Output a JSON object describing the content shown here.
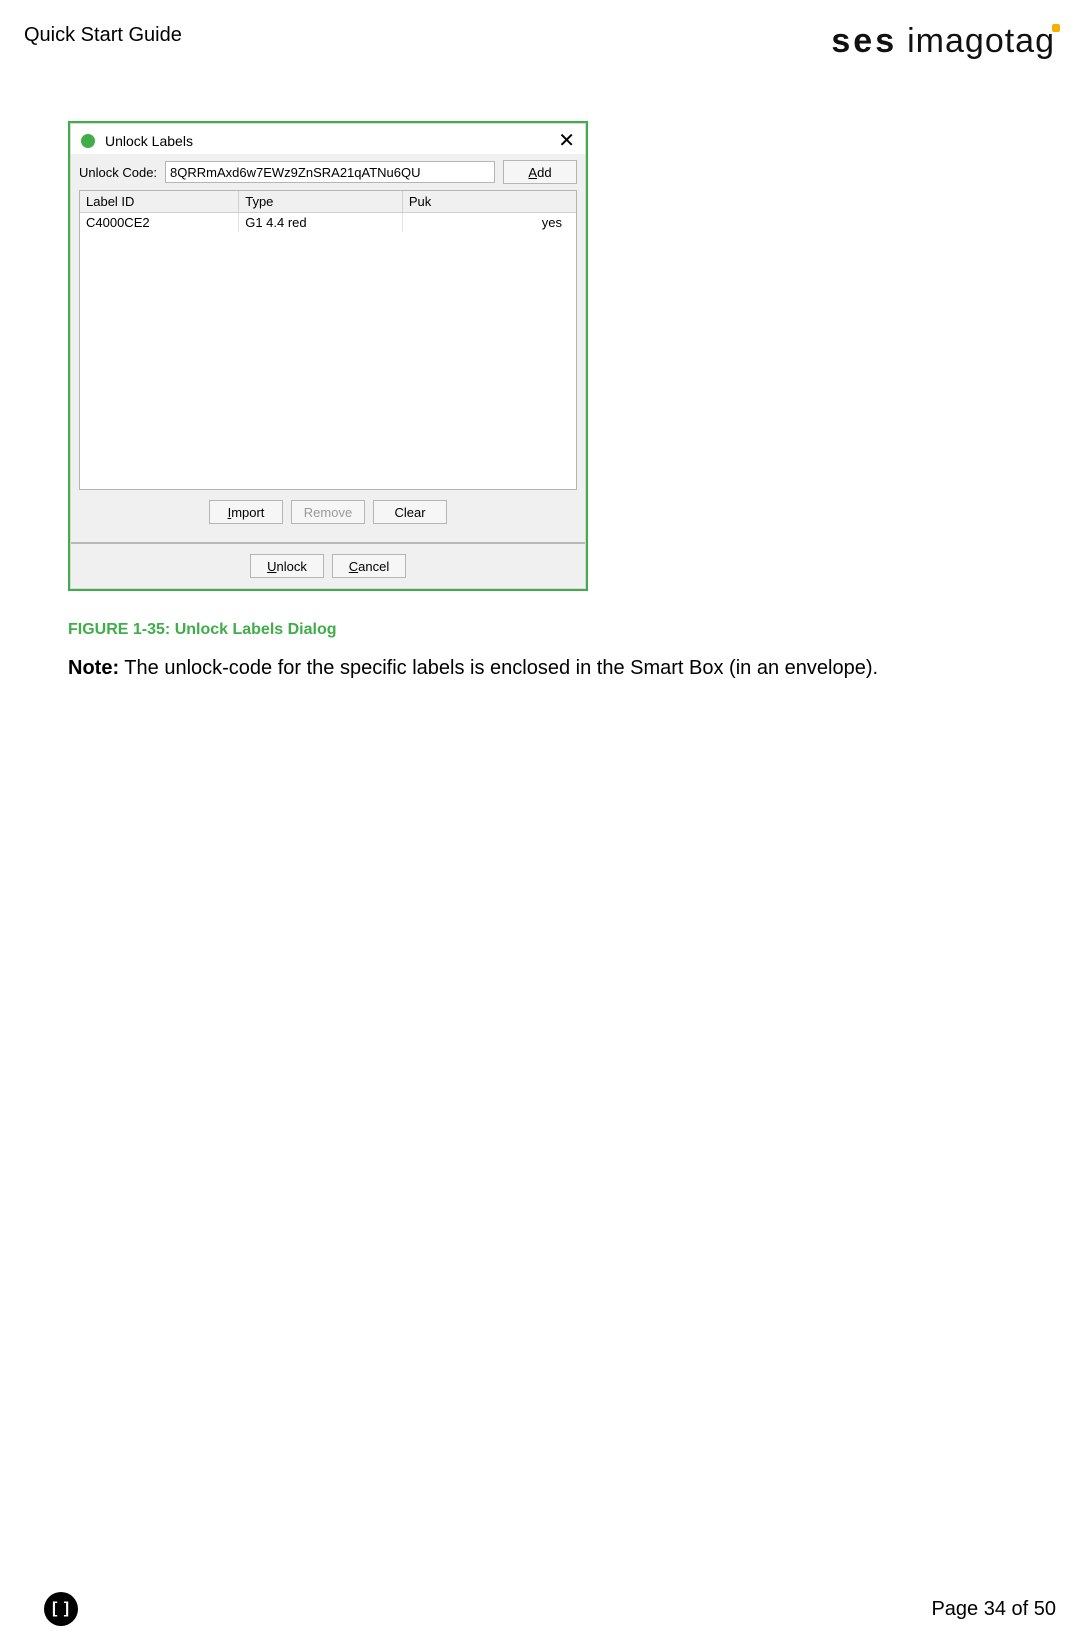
{
  "header": {
    "title": "Quick Start Guide",
    "brand_bold": "ses",
    "brand_light": "imagotag"
  },
  "dialog": {
    "title": "Unlock Labels",
    "close_glyph": "✕",
    "unlock_code_label": "Unlock Code:",
    "unlock_code_value": "8QRRmAxd6w7EWz9ZnSRA21qATNu6QU",
    "add_btn_pre": "",
    "add_btn_mn": "A",
    "add_btn_post": "dd",
    "columns": {
      "c0": "Label ID",
      "c1": "Type",
      "c2": "Puk"
    },
    "row0": {
      "c0": "C4000CE2",
      "c1": "G1 4.4 red",
      "c2": "yes"
    },
    "import_btn_pre": "",
    "import_btn_mn": "I",
    "import_btn_post": "mport",
    "remove_btn": "Remove",
    "clear_btn": "Clear",
    "unlock_btn_pre": "",
    "unlock_btn_mn": "U",
    "unlock_btn_post": "nlock",
    "cancel_btn_pre": "",
    "cancel_btn_mn": "C",
    "cancel_btn_post": "ancel"
  },
  "figure_caption": "FIGURE 1-35: Unlock Labels Dialog",
  "note_label": "Note:",
  "note_text": " The unlock-code for the specific labels is enclosed in the Smart Box (in an envelope).",
  "footer": {
    "badge": "[ ]",
    "page": "Page 34 of 50"
  }
}
